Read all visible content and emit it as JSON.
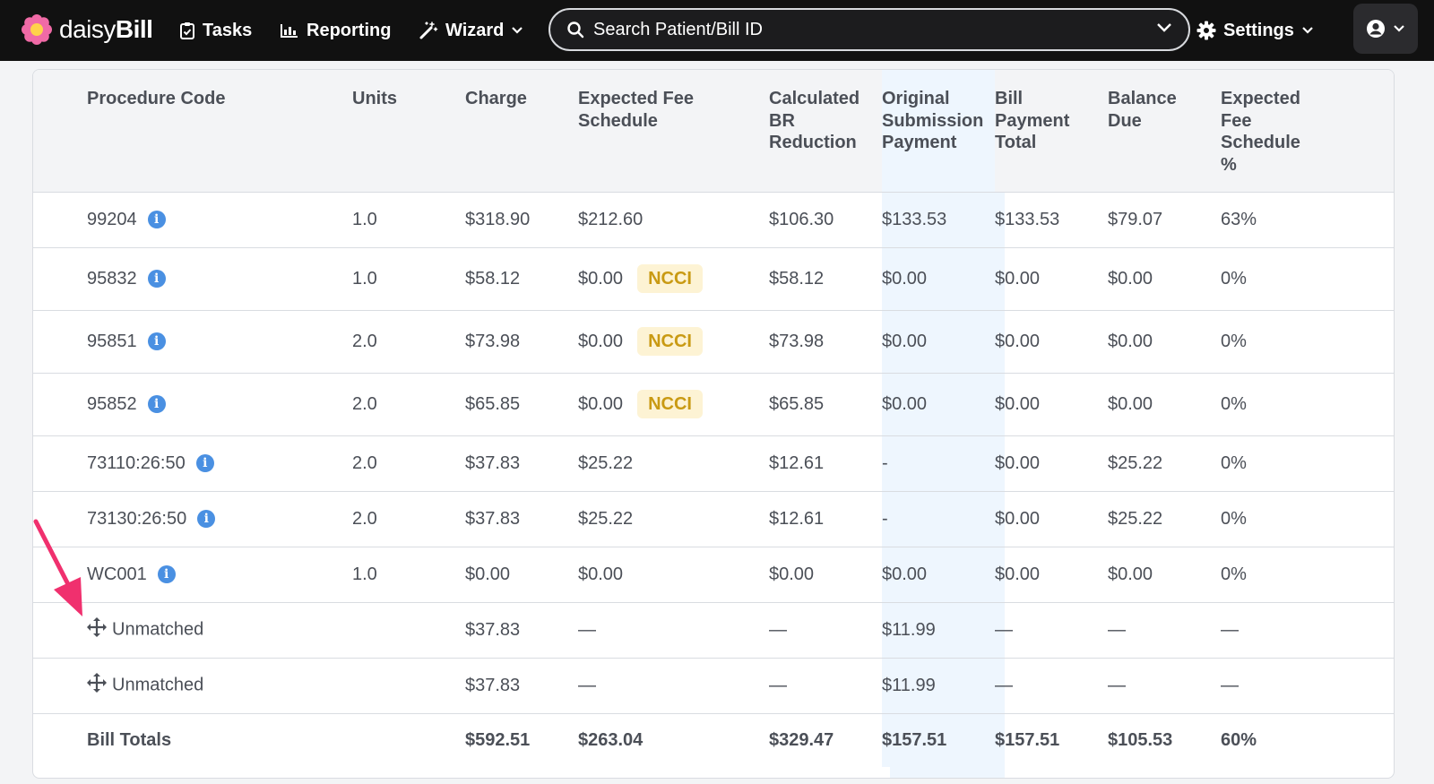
{
  "nav": {
    "logo_text_light": "daisy",
    "logo_text_bold": "Bill",
    "tasks": "Tasks",
    "reporting": "Reporting",
    "wizard": "Wizard",
    "search_placeholder": "Search Patient/Bill ID",
    "settings": "Settings"
  },
  "colors": {
    "nav_bg": "#111111",
    "highlight_column": "#eef6fe",
    "ncci_bg": "#fdf3d4",
    "ncci_text": "#c99a13",
    "info_icon": "#4a90e2",
    "annotation_arrow": "#f0306e"
  },
  "table": {
    "headers": [
      [
        "Procedure Code"
      ],
      [
        "Units"
      ],
      [
        "Charge"
      ],
      [
        "Expected Fee",
        "Schedule"
      ],
      [
        "Calculated",
        "BR",
        "Reduction"
      ],
      [
        "Original",
        "Submission",
        "Payment"
      ],
      [
        "Bill",
        "Payment",
        "Total"
      ],
      [
        "Balance",
        "Due"
      ],
      [
        "Expected",
        "Fee",
        "Schedule",
        "%"
      ]
    ],
    "rows": [
      {
        "code": "99204",
        "units": "1.0",
        "charge": "$318.90",
        "expected_fee": "$212.60",
        "ncci": "",
        "br_reduction": "$106.30",
        "original_payment": "$133.53",
        "bill_payment_total": "$133.53",
        "balance_due": "$79.07",
        "expected_pct": "63%"
      },
      {
        "code": "95832",
        "units": "1.0",
        "charge": "$58.12",
        "expected_fee": "$0.00",
        "ncci": "NCCI",
        "br_reduction": "$58.12",
        "original_payment": "$0.00",
        "bill_payment_total": "$0.00",
        "balance_due": "$0.00",
        "expected_pct": "0%"
      },
      {
        "code": "95851",
        "units": "2.0",
        "charge": "$73.98",
        "expected_fee": "$0.00",
        "ncci": "NCCI",
        "br_reduction": "$73.98",
        "original_payment": "$0.00",
        "bill_payment_total": "$0.00",
        "balance_due": "$0.00",
        "expected_pct": "0%"
      },
      {
        "code": "95852",
        "units": "2.0",
        "charge": "$65.85",
        "expected_fee": "$0.00",
        "ncci": "NCCI",
        "br_reduction": "$65.85",
        "original_payment": "$0.00",
        "bill_payment_total": "$0.00",
        "balance_due": "$0.00",
        "expected_pct": "0%"
      },
      {
        "code": "73110:26:50",
        "units": "2.0",
        "charge": "$37.83",
        "expected_fee": "$25.22",
        "ncci": "",
        "br_reduction": "$12.61",
        "original_payment": "-",
        "bill_payment_total": "$0.00",
        "balance_due": "$25.22",
        "expected_pct": "0%"
      },
      {
        "code": "73130:26:50",
        "units": "2.0",
        "charge": "$37.83",
        "expected_fee": "$25.22",
        "ncci": "",
        "br_reduction": "$12.61",
        "original_payment": "-",
        "bill_payment_total": "$0.00",
        "balance_due": "$25.22",
        "expected_pct": "0%"
      },
      {
        "code": "WC001",
        "units": "1.0",
        "charge": "$0.00",
        "expected_fee": "$0.00",
        "ncci": "",
        "br_reduction": "$0.00",
        "original_payment": "$0.00",
        "bill_payment_total": "$0.00",
        "balance_due": "$0.00",
        "expected_pct": "0%"
      }
    ],
    "unmatched": [
      {
        "label": "Unmatched",
        "charge": "$37.83",
        "expected_fee": "—",
        "br_reduction": "—",
        "original_payment": "$11.99",
        "bill_payment_total": "—",
        "balance_due": "—",
        "expected_pct": "—"
      },
      {
        "label": "Unmatched",
        "charge": "$37.83",
        "expected_fee": "—",
        "br_reduction": "—",
        "original_payment": "$11.99",
        "bill_payment_total": "—",
        "balance_due": "—",
        "expected_pct": "—"
      }
    ],
    "totals": {
      "label": "Bill Totals",
      "charge": "$592.51",
      "expected_fee": "$263.04",
      "br_reduction": "$329.47",
      "original_payment": "$157.51",
      "bill_payment_total": "$157.51",
      "balance_due": "$105.53",
      "expected_pct": "60%"
    }
  }
}
